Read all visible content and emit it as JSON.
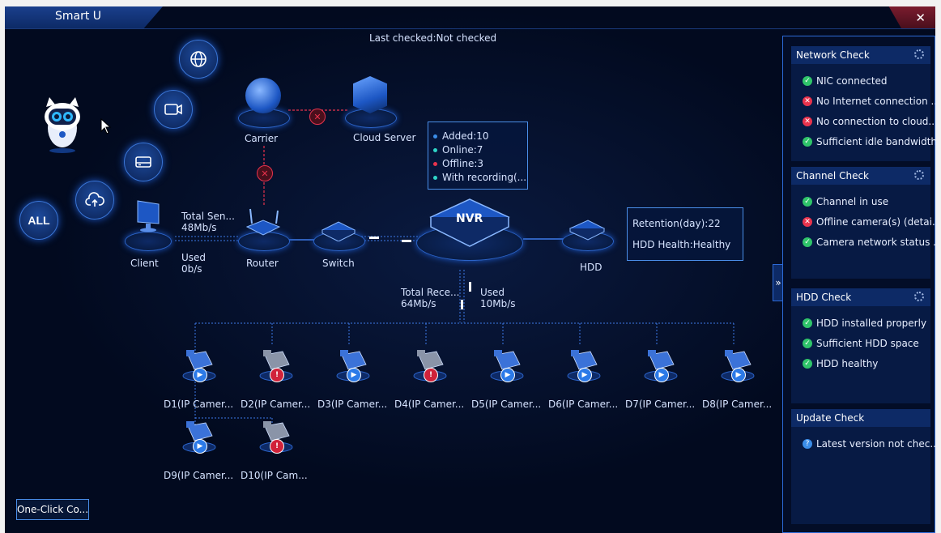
{
  "window": {
    "title": "Smart U",
    "close_label": "✕"
  },
  "last_checked": "Last checked:Not checked",
  "left_buttons": {
    "all_label": "ALL"
  },
  "topology": {
    "carrier": "Carrier",
    "cloud_server": "Cloud Server",
    "client": "Client",
    "router": "Router",
    "switch": "Switch",
    "nvr": "NVR",
    "hdd": "HDD",
    "total_send_label": "Total Sen...",
    "total_send_value": "48Mb/s",
    "used_label": "Used",
    "used_value": "0b/s",
    "total_receive_label": "Total Rece...",
    "total_receive_value": "64Mb/s",
    "used2_label": "Used",
    "used2_value": "10Mb/s"
  },
  "nvr_popup": {
    "items": [
      {
        "text": "Added:10",
        "color": "#3b8de8"
      },
      {
        "text": "Online:7",
        "color": "#2fd6c8"
      },
      {
        "text": "Offline:3",
        "color": "#e8334d"
      },
      {
        "text": "With recording(...",
        "color": "#2fd6c8"
      }
    ]
  },
  "hdd_popup": {
    "retention": "Retention(day):22",
    "health": "HDD Health:Healthy"
  },
  "cameras": [
    {
      "label": "D1(IP Camer...",
      "status": "online"
    },
    {
      "label": "D2(IP Camer...",
      "status": "offline"
    },
    {
      "label": "D3(IP Camer...",
      "status": "online"
    },
    {
      "label": "D4(IP Camer...",
      "status": "offline"
    },
    {
      "label": "D5(IP Camer...",
      "status": "online"
    },
    {
      "label": "D6(IP Camer...",
      "status": "online"
    },
    {
      "label": "D7(IP Camer...",
      "status": "online"
    },
    {
      "label": "D8(IP Camer...",
      "status": "online"
    },
    {
      "label": "D9(IP Camer...",
      "status": "online"
    },
    {
      "label": "D10(IP Cam...",
      "status": "offline"
    }
  ],
  "one_click": "One-Click Co...",
  "panel_toggle": "»",
  "checks": {
    "network": {
      "title": "Network Check",
      "items": [
        {
          "text": "NIC connected",
          "status": "ok"
        },
        {
          "text": "No Internet connection ..",
          "status": "bad"
        },
        {
          "text": "No connection to cloud..",
          "status": "bad"
        },
        {
          "text": "Sufficient idle bandwidth",
          "status": "ok"
        }
      ]
    },
    "channel": {
      "title": "Channel Check",
      "items": [
        {
          "text": "Channel in use",
          "status": "ok"
        },
        {
          "text": "Offline camera(s) (detai..",
          "status": "bad"
        },
        {
          "text": "Camera network status ..",
          "status": "ok"
        }
      ]
    },
    "hdd": {
      "title": "HDD Check",
      "items": [
        {
          "text": "HDD installed properly",
          "status": "ok"
        },
        {
          "text": "Sufficient HDD space",
          "status": "ok"
        },
        {
          "text": "HDD healthy",
          "status": "ok"
        }
      ]
    },
    "update": {
      "title": "Update Check",
      "items": [
        {
          "text": "Latest version not chec...",
          "status": "info"
        }
      ]
    }
  }
}
